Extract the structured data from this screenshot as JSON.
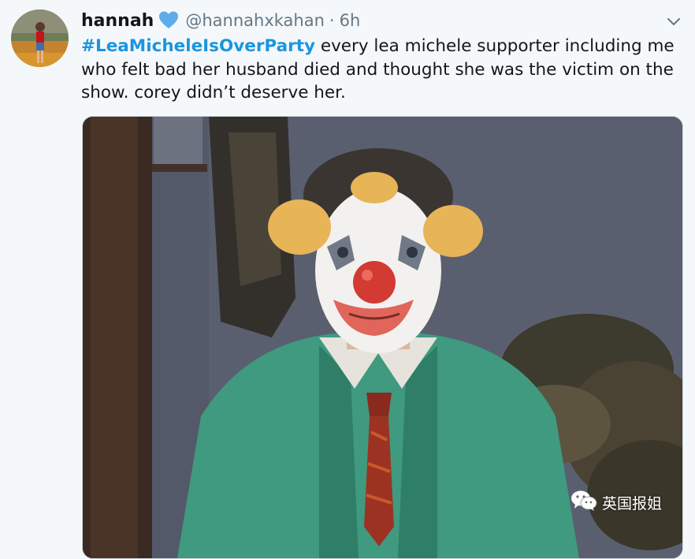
{
  "tweet": {
    "display_name": "hannah",
    "handle": "@hannahxkahan",
    "separator": "·",
    "time": "6h",
    "hashtag": "#LeaMicheleIsOverParty",
    "text": " every lea michele supporter including me who felt bad her husband died and thought she was the victim on the show. corey didn’t deserve her."
  },
  "icons": {
    "badge": "blue-heart-icon",
    "menu": "chevron-down-icon",
    "watermark": "wechat-icon"
  },
  "watermark": {
    "label": "英国报姐"
  },
  "colors": {
    "background": "#f5f8fa",
    "text": "#14171a",
    "muted": "#657786",
    "link": "#1b95e0",
    "heart": "#5dadec"
  }
}
